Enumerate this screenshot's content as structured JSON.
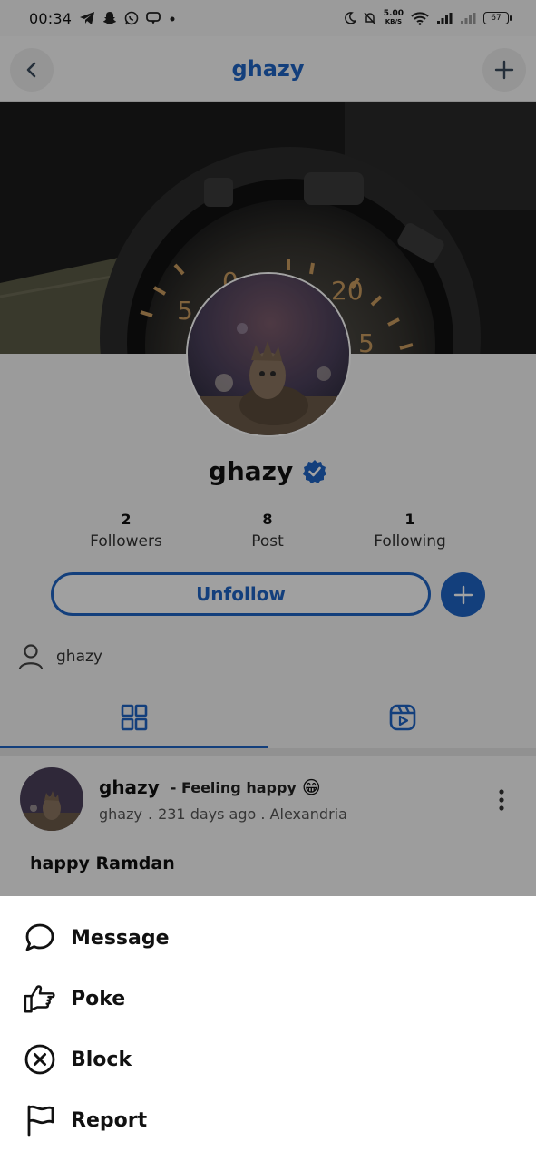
{
  "status_bar": {
    "time": "00:34",
    "net_speed_value": "5.00",
    "net_speed_unit": "KB/S",
    "battery": "67"
  },
  "header": {
    "title": "ghazy",
    "back_icon": "chevron-left-icon",
    "add_icon": "plus-icon"
  },
  "profile": {
    "username": "ghazy",
    "verified": true,
    "stats": [
      {
        "value": "2",
        "label": "Followers"
      },
      {
        "value": "8",
        "label": "Post"
      },
      {
        "value": "1",
        "label": "Following"
      }
    ],
    "unfollow_label": "Unfollow",
    "about_name": "ghazy"
  },
  "tabs": [
    {
      "name": "grid",
      "icon": "grid-icon",
      "active": true
    },
    {
      "name": "reels",
      "icon": "reels-icon",
      "active": false
    }
  ],
  "post": {
    "author": "ghazy",
    "feeling": "- Feeling happy",
    "feeling_emoji": "😁",
    "handle": "ghazy",
    "separator": ".",
    "time_location": "231 days ago . Alexandria",
    "text": "happy Ramdan"
  },
  "sheet": {
    "items": [
      {
        "label": "Message",
        "icon": "chat-bubble-icon"
      },
      {
        "label": "Poke",
        "icon": "poke-hand-icon"
      },
      {
        "label": "Block",
        "icon": "block-circle-icon"
      },
      {
        "label": "Report",
        "icon": "flag-icon"
      }
    ]
  },
  "colors": {
    "accent": "#1e63c3",
    "overlay": "rgba(0,0,0,0.36)"
  }
}
